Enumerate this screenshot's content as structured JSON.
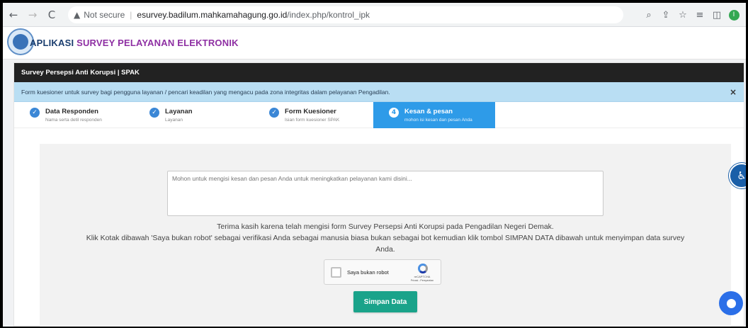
{
  "browser": {
    "back_icon": "←",
    "forward_icon": "→",
    "reload_icon": "C",
    "security_label": "Not secure",
    "url_host": "esurvey.badilum.mahkamahagung.go.id",
    "url_path": "/index.php/kontrol_ipk",
    "icons": [
      "zoom-icon",
      "share-icon",
      "bookmark-star-icon",
      "reading-list-icon",
      "side-panel-icon",
      "profile-icon"
    ],
    "profile_initial": "I"
  },
  "app": {
    "title_prefix": "APLIKASI ",
    "title_accent": "SURVEY PELAYANAN ELEKTRONIK"
  },
  "card": {
    "header": "Survey Persepsi Anti Korupsi | SPAK",
    "info": "Form kuesioner untuk survey bagi pengguna layanan / pencari keadilan yang mengacu pada zona integritas dalam pelayanan Pengadilan.",
    "close_glyph": "×"
  },
  "steps": [
    {
      "title": "Data Responden",
      "sub": "Nama serta detil responden",
      "badge": "✓",
      "done": true
    },
    {
      "title": "Layanan",
      "sub": "Layanan",
      "badge": "✓",
      "done": true
    },
    {
      "title": "Form Kuesioner",
      "sub": "Isian form kuesioner SPAK",
      "badge": "✓",
      "done": true
    },
    {
      "title": "Kesan & pesan",
      "sub": "mohon isi kesan dan pesan Anda",
      "badge": "4",
      "active": true
    }
  ],
  "form": {
    "message_placeholder": "Mohon untuk mengisi kesan dan pesan Anda untuk meningkatkan pelayanan kami disini...",
    "message_value": "",
    "thanks": "Terima kasih karena telah mengisi form Survey Persepsi Anti Korupsi pada Pengadilan Negeri Demak.",
    "instruction": "Klik Kotak dibawah 'Saya bukan robot' sebagai verifikasi Anda sebagai manusia biasa bukan sebagai bot kemudian klik tombol SIMPAN DATA dibawah untuk menyimpan data survey Anda.",
    "captcha_label": "Saya bukan robot",
    "captcha_brand": "reCAPTCHA",
    "captcha_terms": "Privasi - Persyaratan",
    "save_label": "Simpan Data"
  },
  "colors": {
    "accent_purple": "#8e2fa3",
    "active_step": "#2e9be8",
    "save_button": "#1aa38a"
  }
}
